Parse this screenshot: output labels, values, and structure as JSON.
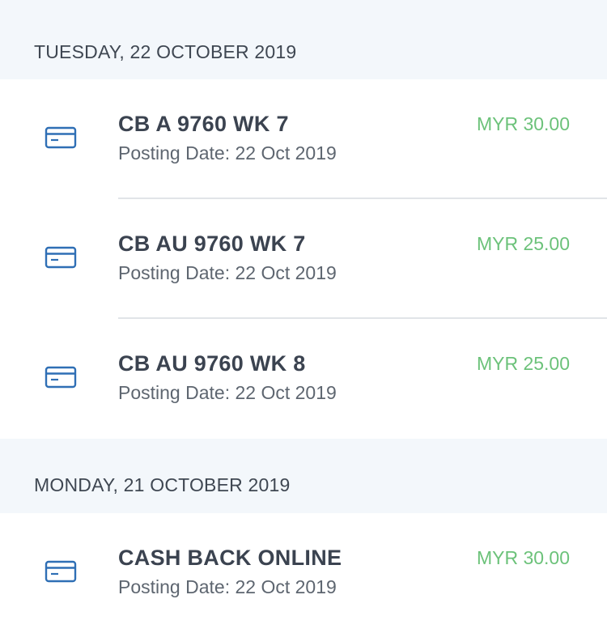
{
  "groups": [
    {
      "date_header": "TUESDAY, 22 OCTOBER 2019",
      "transactions": [
        {
          "title": "CB A 9760 WK 7",
          "posting_date": "Posting Date: 22 Oct 2019",
          "amount": "MYR 30.00",
          "icon": "credit-card-icon"
        },
        {
          "title": "CB AU 9760 WK 7",
          "posting_date": "Posting Date: 22 Oct 2019",
          "amount": "MYR 25.00",
          "icon": "credit-card-icon"
        },
        {
          "title": "CB AU 9760 WK 8",
          "posting_date": "Posting Date: 22 Oct 2019",
          "amount": "MYR 25.00",
          "icon": "credit-card-icon"
        }
      ]
    },
    {
      "date_header": "MONDAY, 21 OCTOBER 2019",
      "transactions": [
        {
          "title": "CASH BACK ONLINE",
          "posting_date": "Posting Date: 22 Oct 2019",
          "amount": "MYR 30.00",
          "icon": "credit-card-icon"
        }
      ]
    }
  ],
  "colors": {
    "header_bg": "#f3f7fb",
    "amount_positive": "#6cc27a",
    "icon_blue": "#2f6fb5",
    "title_text": "#3b4350"
  }
}
